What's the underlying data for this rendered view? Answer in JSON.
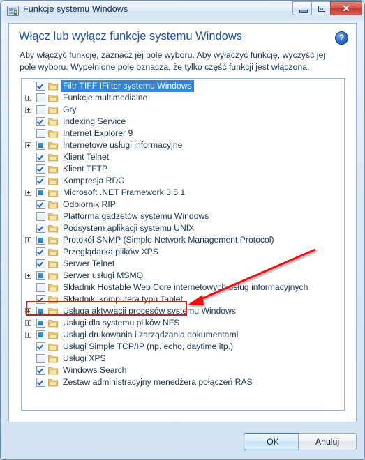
{
  "window": {
    "title": "Funkcje systemu Windows",
    "icon": "windows-features-icon",
    "buttons": {
      "minimize": "minimize-icon",
      "maximize": "restore-icon",
      "close": "✕"
    }
  },
  "content": {
    "heading": "Włącz lub wyłącz funkcje systemu Windows",
    "help_label": "?",
    "description": "Aby włączyć funkcję, zaznacz jej pole wyboru. Aby wyłączyć funkcję, wyczyść jej pole wyboru. Wypełnione pole oznacza, że tylko część funkcji jest włączona."
  },
  "colors": {
    "heading": "#1c4f9c",
    "selection": "#2f86e0",
    "annotation": "#f01111",
    "folder": "#f0c25e"
  },
  "list": {
    "items": [
      {
        "label": "Filtr TIFF IFilter systemu Windows",
        "state": "checked",
        "expandable": false,
        "selected": true
      },
      {
        "label": "Funkcje multimedialne",
        "state": "unchecked",
        "expandable": true,
        "selected": false
      },
      {
        "label": "Gry",
        "state": "unchecked",
        "expandable": true,
        "selected": false
      },
      {
        "label": "Indexing Service",
        "state": "checked",
        "expandable": false,
        "selected": false
      },
      {
        "label": "Internet Explorer 9",
        "state": "unchecked",
        "expandable": false,
        "selected": false
      },
      {
        "label": "Internetowe usługi informacyjne",
        "state": "partial",
        "expandable": true,
        "selected": false
      },
      {
        "label": "Klient Telnet",
        "state": "checked",
        "expandable": false,
        "selected": false
      },
      {
        "label": "Klient TFTP",
        "state": "checked",
        "expandable": false,
        "selected": false
      },
      {
        "label": "Kompresja RDC",
        "state": "checked",
        "expandable": false,
        "selected": false
      },
      {
        "label": "Microsoft .NET Framework 3.5.1",
        "state": "partial",
        "expandable": true,
        "selected": false
      },
      {
        "label": "Odbiornik RIP",
        "state": "checked",
        "expandable": false,
        "selected": false
      },
      {
        "label": "Platforma gadżetów systemu Windows",
        "state": "unchecked",
        "expandable": false,
        "selected": false
      },
      {
        "label": "Podsystem aplikacji systemu UNIX",
        "state": "checked",
        "expandable": false,
        "selected": false
      },
      {
        "label": "Protokół SNMP (Simple Network Management Protocol)",
        "state": "partial",
        "expandable": true,
        "selected": false
      },
      {
        "label": "Przeglądarka plików XPS",
        "state": "checked",
        "expandable": false,
        "selected": false
      },
      {
        "label": "Serwer Telnet",
        "state": "checked",
        "expandable": false,
        "selected": false
      },
      {
        "label": "Serwer usługi MSMQ",
        "state": "partial",
        "expandable": true,
        "selected": false
      },
      {
        "label": "Składnik Hostable Web Core internetowych usług informacyjnych",
        "state": "unchecked",
        "expandable": false,
        "selected": false
      },
      {
        "label": "Składniki komputera typu Tablet",
        "state": "checked",
        "expandable": false,
        "selected": false,
        "highlighted": true
      },
      {
        "label": "Usługa aktywacji procesów systemu Windows",
        "state": "partial",
        "expandable": true,
        "selected": false
      },
      {
        "label": "Usługi dla systemu plików NFS",
        "state": "partial",
        "expandable": true,
        "selected": false
      },
      {
        "label": "Usługi drukowania i zarządzania dokumentami",
        "state": "partial",
        "expandable": true,
        "selected": false
      },
      {
        "label": "Usługi Simple TCP/IP (np. echo, daytime itp.)",
        "state": "checked",
        "expandable": false,
        "selected": false
      },
      {
        "label": "Usługi XPS",
        "state": "unchecked",
        "expandable": false,
        "selected": false
      },
      {
        "label": "Windows Search",
        "state": "checked",
        "expandable": false,
        "selected": false
      },
      {
        "label": "Zestaw administracyjny menedżera połączeń RAS",
        "state": "checked",
        "expandable": false,
        "selected": false
      }
    ]
  },
  "footer": {
    "ok_label": "OK",
    "cancel_label": "Anuluj"
  },
  "annotation": {
    "highlight_target": "Składniki komputera typu Tablet",
    "arrow": "red-arrow-pointing-left"
  }
}
